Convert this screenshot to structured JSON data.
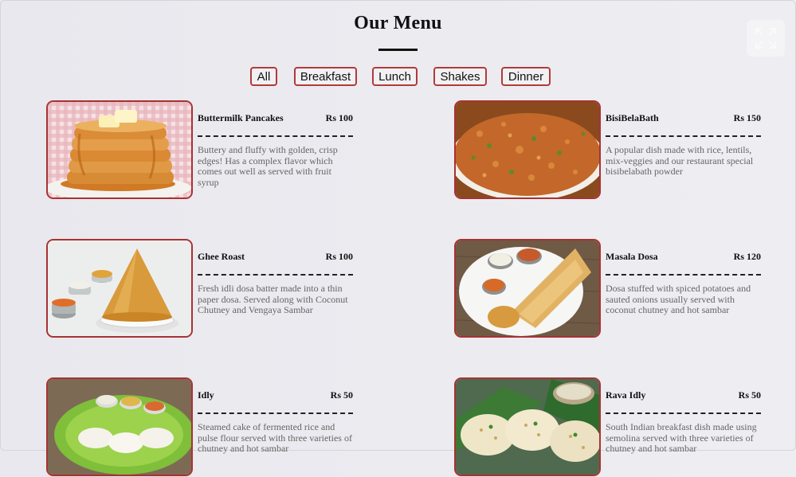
{
  "page": {
    "title": "Our Menu"
  },
  "filters": [
    "All",
    "Breakfast",
    "Lunch",
    "Shakes",
    "Dinner"
  ],
  "colors": {
    "accent": "#b23a3a",
    "background": "#ebebf0",
    "text": "#111111",
    "description": "#666666"
  },
  "menu": [
    {
      "name": "Buttermilk Pancakes",
      "price": "Rs 100",
      "description": "Buttery and fluffy with golden, crisp edges! Has a complex flavor which comes out well as served with fruit syrup",
      "image": "pancakes-photo"
    },
    {
      "name": "BisiBelaBath",
      "price": "Rs 150",
      "description": "A popular dish made with rice, lentils, mix-veggies and our restaurant special bisibelabath powder",
      "image": "bisibelabath-photo"
    },
    {
      "name": "Ghee Roast",
      "price": "Rs 100",
      "description": "Fresh idli dosa batter made into a thin paper dosa. Served along with Coconut Chutney and Vengaya Sambar",
      "image": "ghee-roast-photo"
    },
    {
      "name": "Masala Dosa",
      "price": "Rs 120",
      "description": "Dosa stuffed with spiced potatoes and sauted onions usually served with coconut chutney and hot sambar",
      "image": "masala-dosa-photo"
    },
    {
      "name": "Idly",
      "price": "Rs 50",
      "description": "Steamed cake of fermented rice and pulse flour served with three varieties of chutney and hot sambar",
      "image": "idly-photo"
    },
    {
      "name": "Rava Idly",
      "price": "Rs 50",
      "description": "South Indian breakfast dish made using semolina served with three varieties of chutney and hot sambar",
      "image": "rava-idly-photo"
    }
  ],
  "icons": {
    "fullscreen": "fullscreen-icon"
  }
}
